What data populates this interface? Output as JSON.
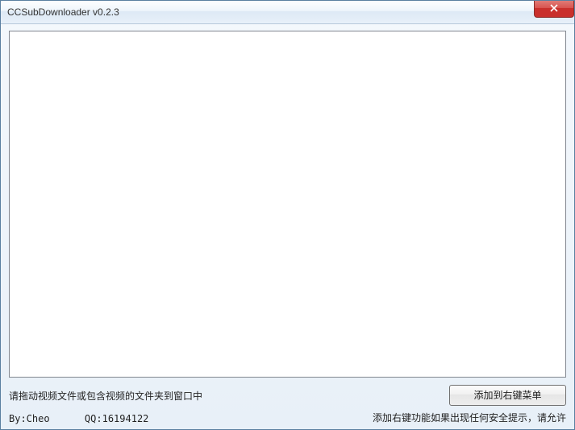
{
  "window": {
    "title": "CCSubDownloader v0.2.3"
  },
  "main": {
    "instruction": "请拖动视频文件或包含视频的文件夹到窗口中",
    "add_button_label": "添加到右键菜单",
    "warning": "添加右键功能如果出现任何安全提示，请允许"
  },
  "credits": {
    "line": "By:Cheo      QQ:16194122"
  }
}
